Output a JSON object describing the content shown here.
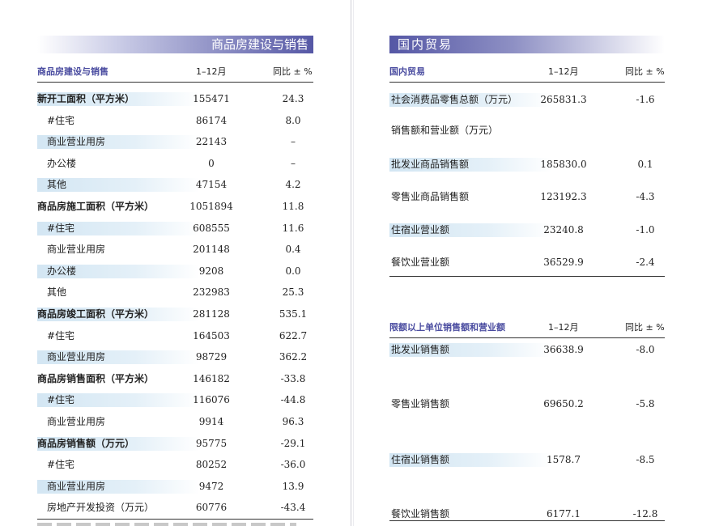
{
  "left": {
    "banner": "商品房建设与销售",
    "header": {
      "label": "商品房建设与销售",
      "period": "1–12月",
      "change": "同比 ± %"
    },
    "rows": [
      {
        "label": "新开工面积（平方米）",
        "value": "155471",
        "change": "24.3",
        "bold": true,
        "band": true
      },
      {
        "label": "#住宅",
        "value": "86174",
        "change": "8.0",
        "bold": false,
        "band": false
      },
      {
        "label": "商业营业用房",
        "value": "22143",
        "change": "–",
        "bold": false,
        "band": true
      },
      {
        "label": "办公楼",
        "value": "0",
        "change": "–",
        "bold": false,
        "band": false
      },
      {
        "label": "其他",
        "value": "47154",
        "change": "4.2",
        "bold": false,
        "band": true
      },
      {
        "label": "商品房施工面积（平方米）",
        "value": "1051894",
        "change": "11.8",
        "bold": true,
        "band": false
      },
      {
        "label": "#住宅",
        "value": "608555",
        "change": "11.6",
        "bold": false,
        "band": true
      },
      {
        "label": "商业营业用房",
        "value": "201148",
        "change": "0.4",
        "bold": false,
        "band": false
      },
      {
        "label": "办公楼",
        "value": "9208",
        "change": "0.0",
        "bold": false,
        "band": true
      },
      {
        "label": "其他",
        "value": "232983",
        "change": "25.3",
        "bold": false,
        "band": false
      },
      {
        "label": "商品房竣工面积（平方米）",
        "value": "281128",
        "change": "535.1",
        "bold": true,
        "band": true
      },
      {
        "label": "#住宅",
        "value": "164503",
        "change": "622.7",
        "bold": false,
        "band": false
      },
      {
        "label": "商业营业用房",
        "value": "98729",
        "change": "362.2",
        "bold": false,
        "band": true
      },
      {
        "label": "商品房销售面积（平方米）",
        "value": "146182",
        "change": "-33.8",
        "bold": true,
        "band": false
      },
      {
        "label": "#住宅",
        "value": "116076",
        "change": "-44.8",
        "bold": false,
        "band": true
      },
      {
        "label": "商业营业用房",
        "value": "9914",
        "change": "96.3",
        "bold": false,
        "band": false
      },
      {
        "label": "商品房销售额（万元）",
        "value": "95775",
        "change": "-29.1",
        "bold": true,
        "band": true
      },
      {
        "label": "#住宅",
        "value": "80252",
        "change": "-36.0",
        "bold": false,
        "band": false
      },
      {
        "label": "商业营业用房",
        "value": "9472",
        "change": "13.9",
        "bold": false,
        "band": true
      },
      {
        "label": "房地产开发投资（万元）",
        "value": "60776",
        "change": "-43.4",
        "bold": false,
        "band": false
      }
    ]
  },
  "right": {
    "banner": "国内贸易",
    "header1": {
      "label": "国内贸易",
      "period": "1–12月",
      "change": "同比 ± %"
    },
    "rows1": [
      {
        "label": "社会消费品零售总额（万元）",
        "value": "265831.3",
        "change": "-1.6",
        "band": true
      },
      {
        "label": "销售额和营业额（万元）",
        "value": "",
        "change": "",
        "band": false
      },
      {
        "label": "批发业商品销售额",
        "value": "185830.0",
        "change": "0.1",
        "band": true
      },
      {
        "label": "零售业商品销售额",
        "value": "123192.3",
        "change": "-4.3",
        "band": false
      },
      {
        "label": "住宿业营业额",
        "value": "23240.8",
        "change": "-1.0",
        "band": true
      },
      {
        "label": "餐饮业营业额",
        "value": "36529.9",
        "change": "-2.4",
        "band": false
      }
    ],
    "header2": {
      "label": "限额以上单位销售额和营业额",
      "period": "1–12月",
      "change": "同比 ± %"
    },
    "rows2": [
      {
        "label": "批发业销售额",
        "value": "36638.9",
        "change": "-8.0",
        "band": true
      },
      {
        "label": "零售业销售额",
        "value": "69650.2",
        "change": "-5.8",
        "band": false
      },
      {
        "label": "住宿业销售额",
        "value": "1578.7",
        "change": "-8.5",
        "band": true
      },
      {
        "label": "餐饮业销售额",
        "value": "6177.1",
        "change": "-12.8",
        "band": false
      }
    ]
  }
}
